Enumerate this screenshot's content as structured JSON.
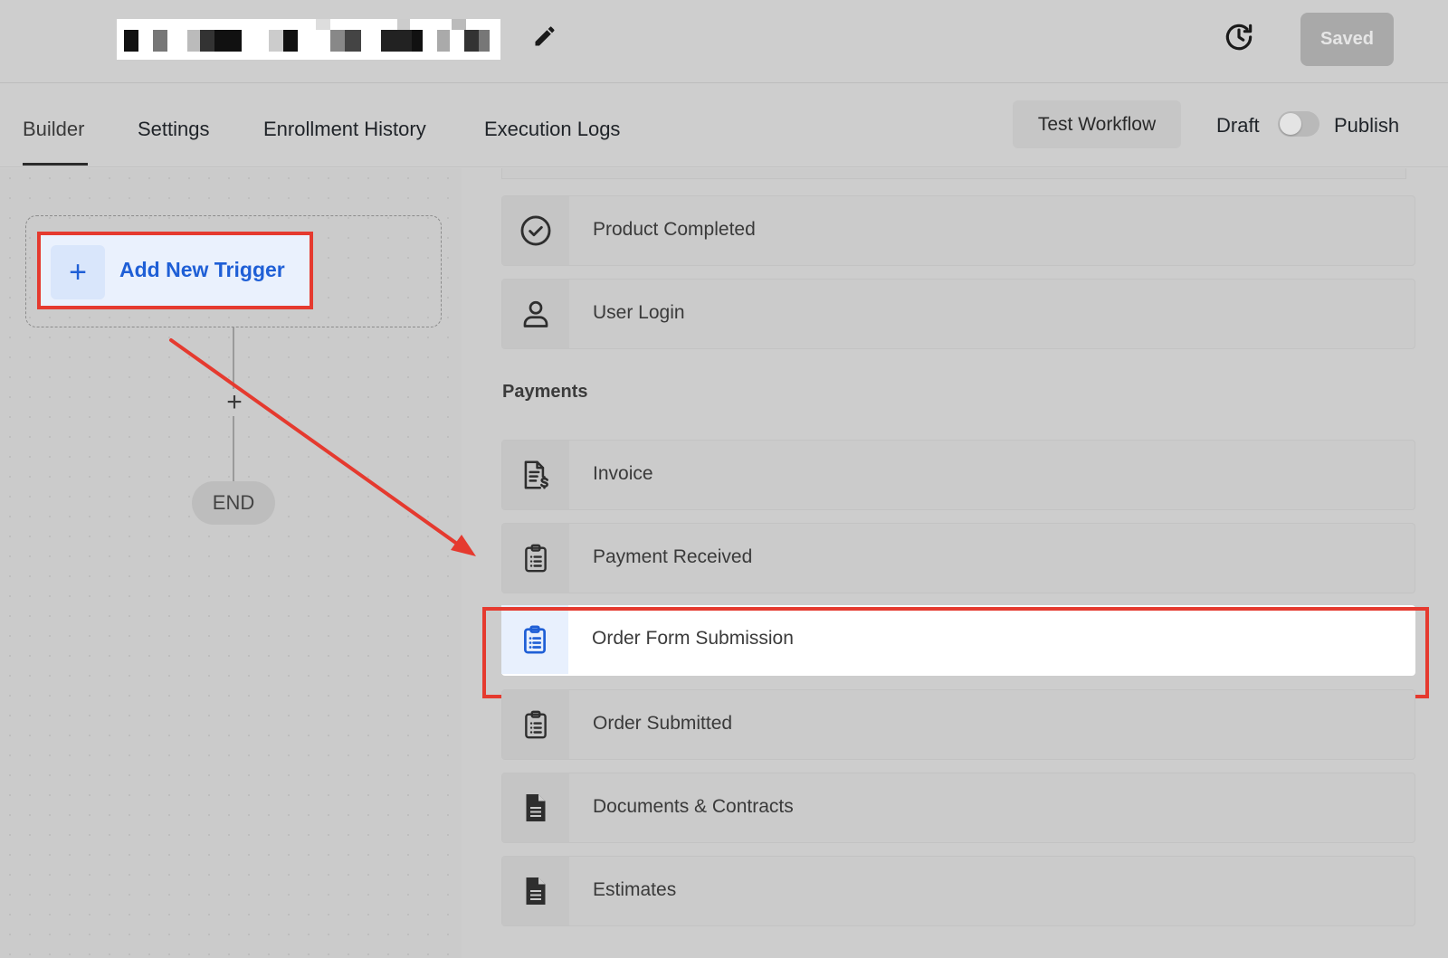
{
  "header": {
    "saved_label": "Saved"
  },
  "tabs": [
    {
      "label": "Builder"
    },
    {
      "label": "Settings"
    },
    {
      "label": "Enrollment History"
    },
    {
      "label": "Execution Logs"
    }
  ],
  "actions": {
    "test_workflow_label": "Test Workflow",
    "draft_label": "Draft",
    "publish_label": "Publish",
    "publish_toggle_on": false
  },
  "canvas": {
    "add_trigger_label": "Add New Trigger",
    "add_step_symbol": "+",
    "end_label": "END"
  },
  "trigger_panel": {
    "items_top": [
      {
        "label": "Product Completed",
        "icon": "check-circle-icon"
      },
      {
        "label": "User Login",
        "icon": "user-icon"
      }
    ],
    "section_payments": "Payments",
    "items_payments": [
      {
        "label": "Invoice",
        "icon": "invoice-icon"
      },
      {
        "label": "Payment Received",
        "icon": "clipboard-list-icon"
      },
      {
        "label": "Order Form Submission",
        "icon": "clipboard-list-icon",
        "selected": true
      },
      {
        "label": "Order Submitted",
        "icon": "clipboard-list-icon"
      },
      {
        "label": "Documents & Contracts",
        "icon": "document-icon"
      },
      {
        "label": "Estimates",
        "icon": "document-icon"
      }
    ]
  },
  "colors": {
    "accent_blue": "#1f5fd6",
    "highlight_red": "#e53a2f"
  }
}
